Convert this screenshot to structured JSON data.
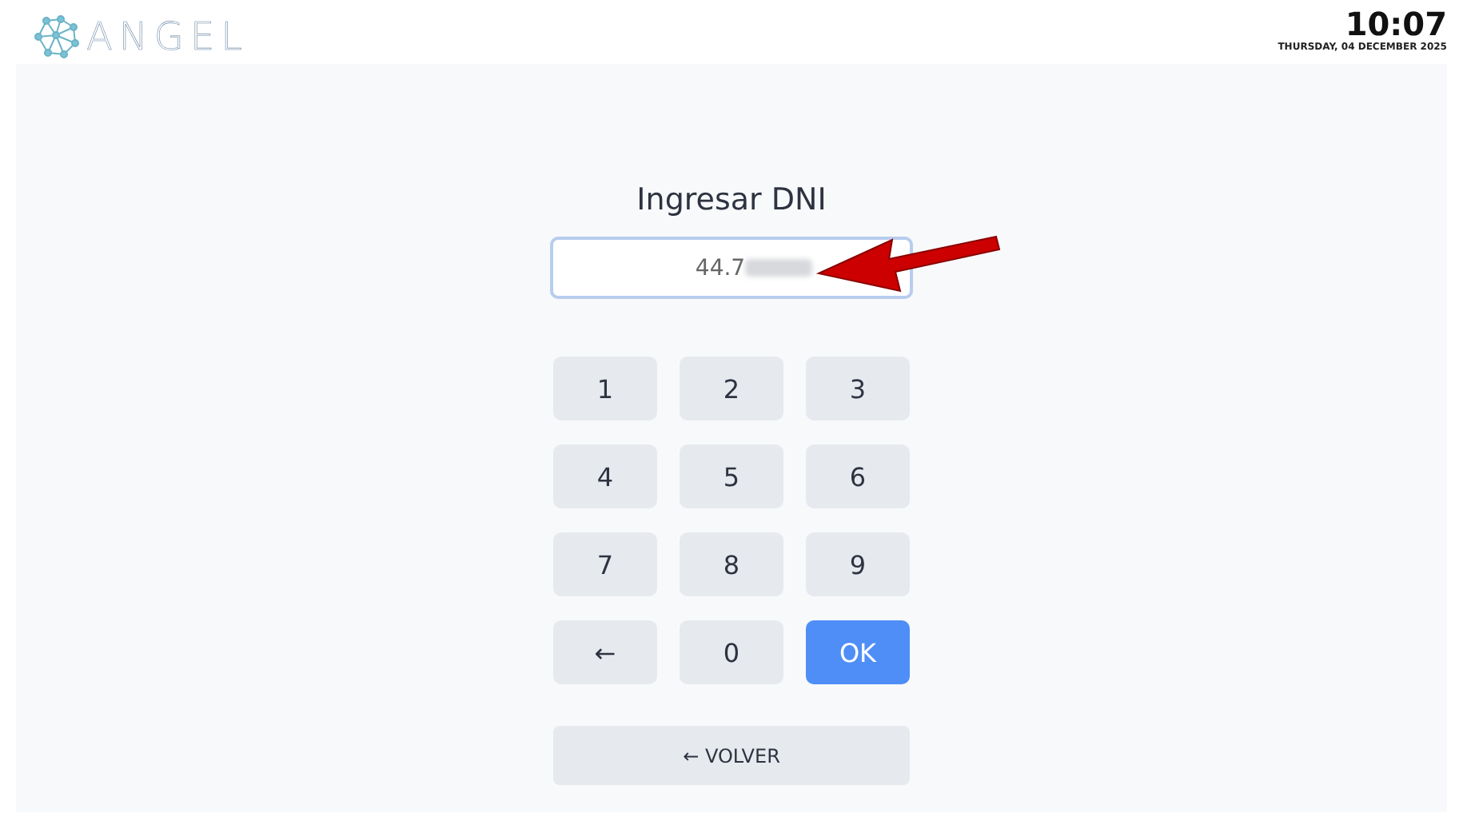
{
  "header": {
    "logo_text": "ANGEL",
    "time": "10:07",
    "date": "THURSDAY, 04 DECEMBER 2025"
  },
  "form": {
    "title": "Ingresar DNI",
    "field": {
      "value": "44.7",
      "redacted": true
    }
  },
  "keypad": [
    {
      "label": "1",
      "kind": "digit"
    },
    {
      "label": "2",
      "kind": "digit"
    },
    {
      "label": "3",
      "kind": "digit"
    },
    {
      "label": "4",
      "kind": "digit"
    },
    {
      "label": "5",
      "kind": "digit"
    },
    {
      "label": "6",
      "kind": "digit"
    },
    {
      "label": "7",
      "kind": "digit"
    },
    {
      "label": "8",
      "kind": "digit"
    },
    {
      "label": "9",
      "kind": "digit"
    },
    {
      "label": "←",
      "kind": "back"
    },
    {
      "label": "0",
      "kind": "digit"
    },
    {
      "label": "OK",
      "kind": "ok"
    }
  ],
  "back_button": {
    "label": "← VOLVER"
  },
  "annotation": {
    "kind": "arrow"
  }
}
